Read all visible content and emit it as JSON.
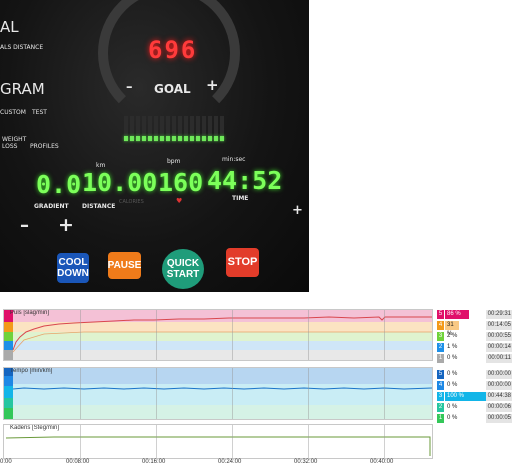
{
  "console": {
    "left_labels": [
      "AL",
      "ALS  DISTANCE",
      "GRAM",
      "CUSTOM",
      "TEST",
      "WEIGHT LOSS",
      "PROFILES"
    ],
    "goal_value": "696",
    "goal_label": "GOAL",
    "goal_minus": "–",
    "goal_plus": "+",
    "units": {
      "km": "km",
      "bpm": "bpm",
      "minsec": "min:sec"
    },
    "readouts": {
      "gradient": "0.0",
      "distance": "10.00",
      "heart_rate": "160",
      "time": "44:52"
    },
    "readout_labels": {
      "gradient": "GRADIENT",
      "distance": "DISTANCE",
      "calories": "CALORIES",
      "time": "TIME"
    },
    "minus_sign": "–",
    "plus_sign": "+",
    "buttons": {
      "cool_down": "COOL DOWN",
      "pause": "PAUSE",
      "quick_start": "QUICK START",
      "stop": "STOP"
    }
  },
  "charts": {
    "pulse_title": "Puls [slag/min]",
    "speed_title": "Tempo [min/km]",
    "cadence_title": "Kadens [Steg/min]",
    "x_ticks": [
      "0:00",
      "00:08:00",
      "00:16:00",
      "00:24:00",
      "00:32:00",
      "00:40:00"
    ]
  },
  "pulse_zones": [
    {
      "zone": "5",
      "pct": "86 %",
      "time": "00:29:31",
      "color": "#e0106a"
    },
    {
      "zone": "4",
      "pct": "31 %",
      "time": "00:14:05",
      "color": "#f39a1a"
    },
    {
      "zone": "3",
      "pct": "2 %",
      "time": "00:00:55",
      "color": "#6fd23a"
    },
    {
      "zone": "2",
      "pct": "1 %",
      "time": "00:00:14",
      "color": "#1e90e8"
    },
    {
      "zone": "1",
      "pct": "0 %",
      "time": "00:00:11",
      "color": "#aaaaaa"
    }
  ],
  "speed_zones": [
    {
      "zone": "5",
      "pct": "0 %",
      "time": "00:00:00",
      "color": "#1565c0"
    },
    {
      "zone": "4",
      "pct": "0 %",
      "time": "00:00:00",
      "color": "#1e88e5"
    },
    {
      "zone": "3",
      "pct": "100 %",
      "time": "00:44:38",
      "color": "#12b5e8"
    },
    {
      "zone": "2",
      "pct": "0 %",
      "time": "00:00:06",
      "color": "#26c6a0"
    },
    {
      "zone": "1",
      "pct": "0 %",
      "time": "00:00:05",
      "color": "#34c759"
    }
  ],
  "colors": {
    "pulse_zone5": "#f4c1d6",
    "pulse_zone4": "#fbe3c2",
    "pulse_zone3": "#dff3cf",
    "pulse_zone2": "#cfe6f8",
    "pulse_zone1": "#e8e8e8",
    "pulse_line": "#d9464e",
    "speed_band_top": "#b7d6f1",
    "speed_band_mid": "#c9edf5",
    "speed_band_low": "#d5f2e6",
    "speed_line": "#1a73c9",
    "cadence_line": "#6a9a3a"
  }
}
